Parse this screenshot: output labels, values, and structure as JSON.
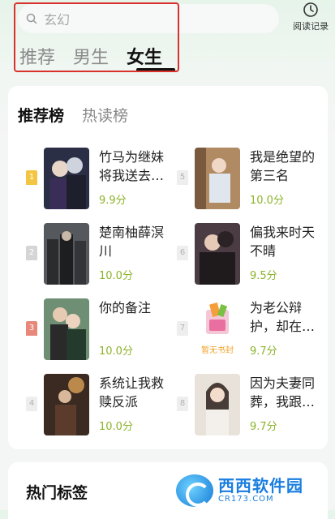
{
  "search": {
    "placeholder": "玄幻"
  },
  "header": {
    "history_label": "阅读记录"
  },
  "tabs": [
    {
      "label": "推荐",
      "active": false
    },
    {
      "label": "男生",
      "active": false
    },
    {
      "label": "女生",
      "active": true
    }
  ],
  "ranking": {
    "tabs": [
      {
        "label": "推荐榜",
        "active": true
      },
      {
        "label": "热读榜",
        "active": false
      }
    ],
    "books": [
      {
        "rank": "1",
        "title": "竹马为继妹将我送去…",
        "score": "9.9分"
      },
      {
        "rank": "2",
        "title": "楚南柚薛溟川",
        "score": "10.0分"
      },
      {
        "rank": "3",
        "title": "你的备注",
        "score": "10.0分"
      },
      {
        "rank": "4",
        "title": "系统让我救赎反派",
        "score": "10.0分"
      },
      {
        "rank": "5",
        "title": "我是绝望的第三名",
        "score": "10.0分"
      },
      {
        "rank": "6",
        "title": "偏我来时天不晴",
        "score": "9.5分"
      },
      {
        "rank": "7",
        "title": "为老公辩护，却在…",
        "score": "9.7分",
        "cover_text": "暂无书封"
      },
      {
        "rank": "8",
        "title": "因为夫妻同葬，我跟…",
        "score": "9.7分"
      }
    ]
  },
  "hot_tags": {
    "title": "热门标签"
  },
  "watermark": {
    "main": "西西软件园",
    "sub": "CR173.COM"
  },
  "colors": {
    "accent_green": "#8cb42b",
    "highlight_red": "#d9322c"
  }
}
